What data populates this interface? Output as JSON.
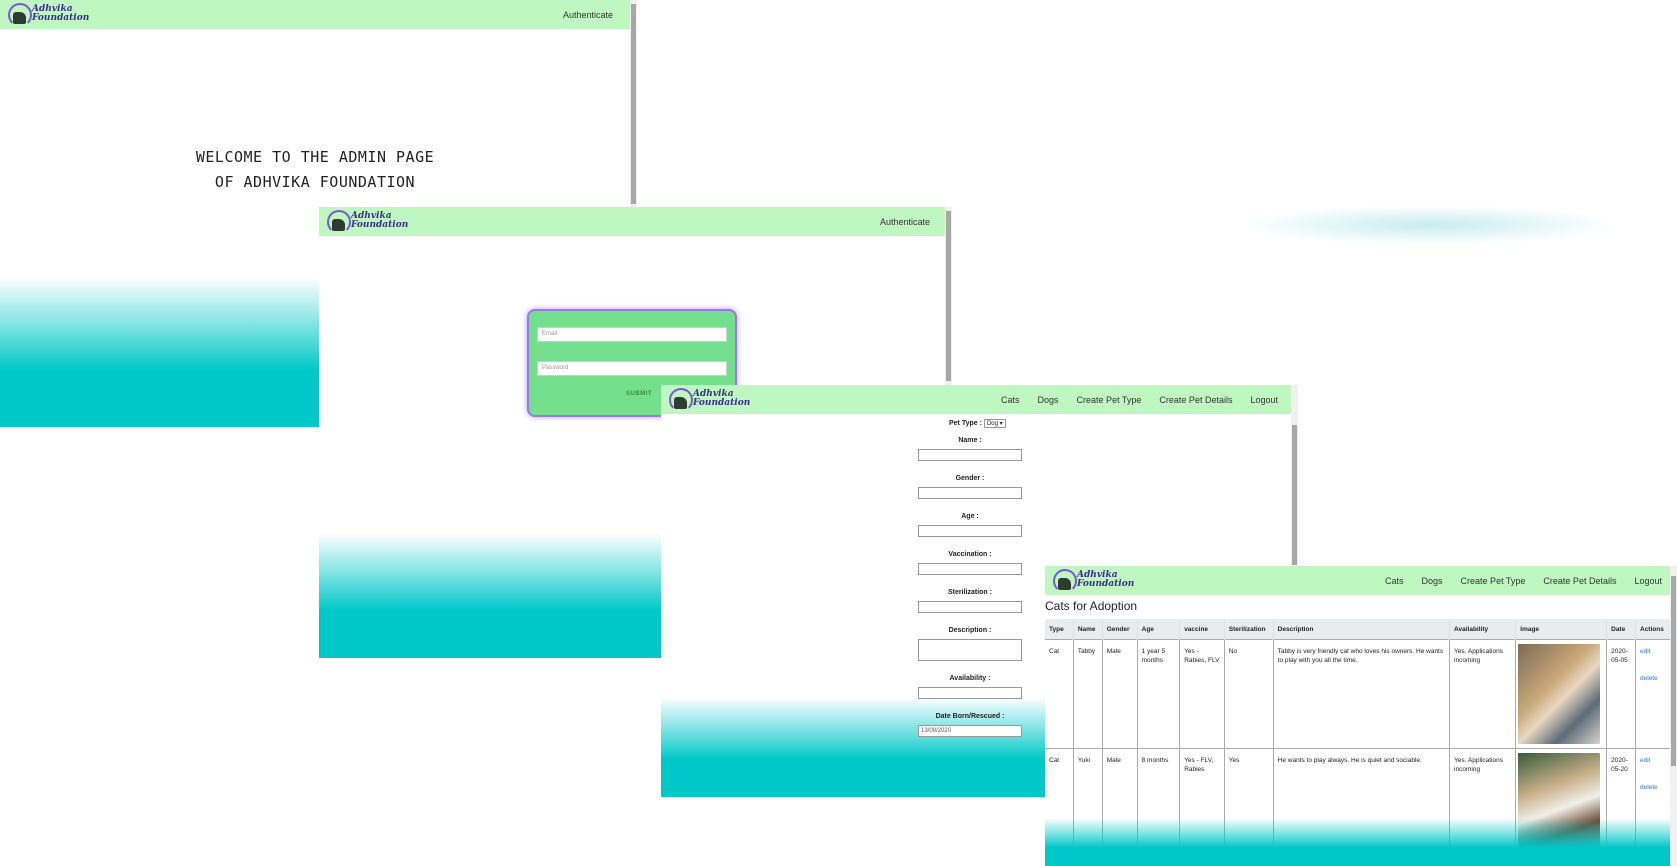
{
  "brand": {
    "line1": "Adhvika",
    "line2": "Foundation"
  },
  "window1": {
    "nav_link": "Authenticate",
    "welcome_line1": "WELCOME TO THE ADMIN PAGE",
    "welcome_line2": "OF ADHVIKA FOUNDATION"
  },
  "window2": {
    "nav_link": "Authenticate",
    "email_placeholder": "Email",
    "password_placeholder": "Password",
    "submit_label": "SUBMIT"
  },
  "window3": {
    "nav": [
      "Cats",
      "Dogs",
      "Create Pet Type",
      "Create Pet Details",
      "Logout"
    ],
    "pet_type_label": "Pet Type :",
    "pet_type_value": "Dog",
    "labels": {
      "name": "Name :",
      "gender": "Gender :",
      "age": "Age :",
      "vaccination": "Vaccination :",
      "sterilization": "Sterilization :",
      "description": "Description :",
      "availability": "Availability :",
      "date": "Date Born/Rescued :"
    },
    "date_value": "13/09/2020"
  },
  "window4": {
    "nav": [
      "Cats",
      "Dogs",
      "Create Pet Type",
      "Create Pet Details",
      "Logout"
    ],
    "title": "Cats for Adoption",
    "columns": [
      "Type",
      "Name",
      "Gender",
      "Age",
      "vaccine",
      "Sterilization",
      "Description",
      "Availability",
      "Image",
      "Date",
      "Actions"
    ],
    "rows": [
      {
        "type": "Cat",
        "name": "Tabby",
        "gender": "Male",
        "age": "1 year 5 months",
        "vaccine": "Yes - Rabies, FLV",
        "sterilization": "No",
        "description": "Tabby is very friendly cat who loves his owners. He wants to play with you all the time.",
        "availability": "Yes. Applications incoming",
        "date": "2020-05-05",
        "edit": "edit",
        "delete": "delete"
      },
      {
        "type": "Cat",
        "name": "Yuki",
        "gender": "Male",
        "age": "8 months",
        "vaccine": "Yes - FLV, Rabies",
        "sterilization": "Yes",
        "description": "He wants to play always. He is quiet and sociable.",
        "availability": "Yes. Applications incoming",
        "date": "2020-05-20",
        "edit": "edit",
        "delete": "delete"
      }
    ]
  },
  "colors": {
    "navbar": "#bff7c0",
    "teal": "#00c8c8",
    "login_card": "#74e08e",
    "accent_purple": "#9d77e8"
  }
}
